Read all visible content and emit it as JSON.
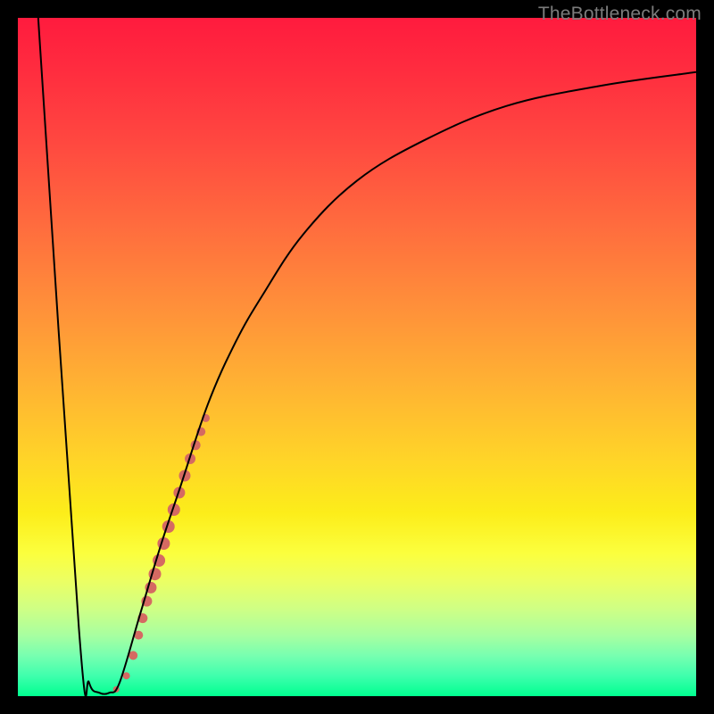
{
  "watermark_text": "TheBottleneck.com",
  "chart_data": {
    "type": "line",
    "title": "",
    "xlabel": "",
    "ylabel": "",
    "xlim": [
      0,
      100
    ],
    "ylim": [
      0,
      100
    ],
    "grid": false,
    "legend": false,
    "curve_description": "Black curve: steep linear drop from top at x≈3 down to y≈0 at x≈12, then rises as a saturating curve toward y≈92 at x=100.",
    "curve_points": [
      {
        "x": 3.0,
        "y": 100.0
      },
      {
        "x": 9.0,
        "y": 10.0
      },
      {
        "x": 10.5,
        "y": 2.0
      },
      {
        "x": 12.0,
        "y": 0.5
      },
      {
        "x": 13.5,
        "y": 0.5
      },
      {
        "x": 15.0,
        "y": 2.0
      },
      {
        "x": 18.0,
        "y": 12.0
      },
      {
        "x": 21.0,
        "y": 22.0
      },
      {
        "x": 24.0,
        "y": 31.0
      },
      {
        "x": 28.0,
        "y": 43.0
      },
      {
        "x": 32.0,
        "y": 52.0
      },
      {
        "x": 36.0,
        "y": 59.0
      },
      {
        "x": 42.0,
        "y": 68.0
      },
      {
        "x": 50.0,
        "y": 76.0
      },
      {
        "x": 60.0,
        "y": 82.0
      },
      {
        "x": 72.0,
        "y": 87.0
      },
      {
        "x": 86.0,
        "y": 90.0
      },
      {
        "x": 100.0,
        "y": 92.0
      }
    ],
    "highlighted_markers_description": "Salmon-colored markers along the rising section of the curve between roughly x=15 and x=28, denser and fatter in the middle of that segment.",
    "markers": [
      {
        "x": 14.5,
        "y": 1.0,
        "r": 3.5
      },
      {
        "x": 16.0,
        "y": 3.0,
        "r": 4.0
      },
      {
        "x": 17.0,
        "y": 6.0,
        "r": 5.0
      },
      {
        "x": 17.8,
        "y": 9.0,
        "r": 5.0
      },
      {
        "x": 18.4,
        "y": 11.5,
        "r": 5.5
      },
      {
        "x": 19.0,
        "y": 14.0,
        "r": 6.0
      },
      {
        "x": 19.6,
        "y": 16.0,
        "r": 6.5
      },
      {
        "x": 20.2,
        "y": 18.0,
        "r": 7.0
      },
      {
        "x": 20.8,
        "y": 20.0,
        "r": 7.0
      },
      {
        "x": 21.5,
        "y": 22.5,
        "r": 7.0
      },
      {
        "x": 22.2,
        "y": 25.0,
        "r": 7.0
      },
      {
        "x": 23.0,
        "y": 27.5,
        "r": 7.0
      },
      {
        "x": 23.8,
        "y": 30.0,
        "r": 6.5
      },
      {
        "x": 24.6,
        "y": 32.5,
        "r": 6.5
      },
      {
        "x": 25.4,
        "y": 35.0,
        "r": 6.0
      },
      {
        "x": 26.2,
        "y": 37.0,
        "r": 5.5
      },
      {
        "x": 27.0,
        "y": 39.0,
        "r": 5.0
      },
      {
        "x": 27.7,
        "y": 41.0,
        "r": 4.5
      }
    ],
    "marker_color": "#d56a62",
    "curve_color": "#000000",
    "gradient_stops": [
      {
        "pos": 0,
        "color": "#ff1b3e"
      },
      {
        "pos": 50,
        "color": "#ffc22c"
      },
      {
        "pos": 80,
        "color": "#fbff3e"
      },
      {
        "pos": 100,
        "color": "#00ff90"
      }
    ]
  }
}
